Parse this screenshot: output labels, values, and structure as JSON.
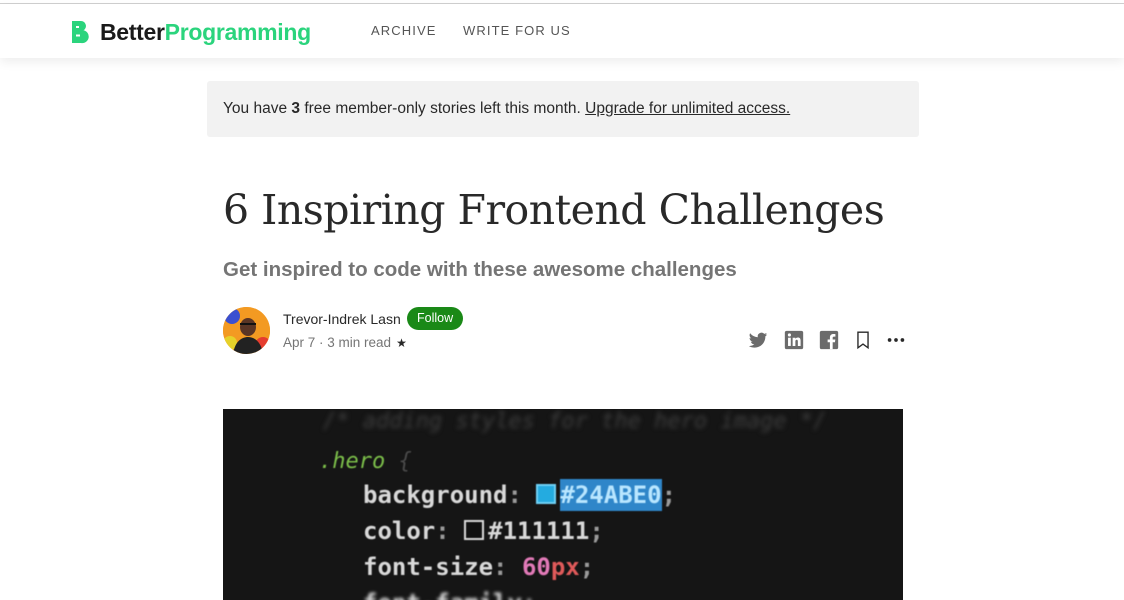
{
  "header": {
    "logo_part1": "Better",
    "logo_part2": "Programming",
    "nav": [
      "ARCHIVE",
      "WRITE FOR US"
    ]
  },
  "banner": {
    "prefix": "You have ",
    "count": "3",
    "middle": " free member-only stories left this month. ",
    "link": "Upgrade for unlimited access."
  },
  "article": {
    "title": "6 Inspiring Frontend Challenges",
    "subtitle": "Get inspired to code with these awesome challenges",
    "author": "Trevor-Indrek Lasn",
    "follow_label": "Follow",
    "date": "Apr 7",
    "separator": " · ",
    "read_time": "3 min read",
    "member_star": "★"
  },
  "share_icons": [
    "twitter-icon",
    "linkedin-icon",
    "facebook-icon",
    "bookmark-icon",
    "more-icon"
  ],
  "hero_code": {
    "comment": "/* adding styles for the hero image */",
    "selector": ".hero",
    "open_brace": " {",
    "lines": [
      {
        "prop": "background",
        "value": "#24ABE0"
      },
      {
        "prop": "color",
        "value": "#111111"
      },
      {
        "prop": "font-size",
        "num": "60",
        "unit": "px"
      },
      {
        "prop": "font-family",
        "value": "..."
      }
    ]
  },
  "colors": {
    "brand_green": "#2bd47d",
    "follow_green": "#1a8917",
    "banner_bg": "#f2f2f2"
  }
}
